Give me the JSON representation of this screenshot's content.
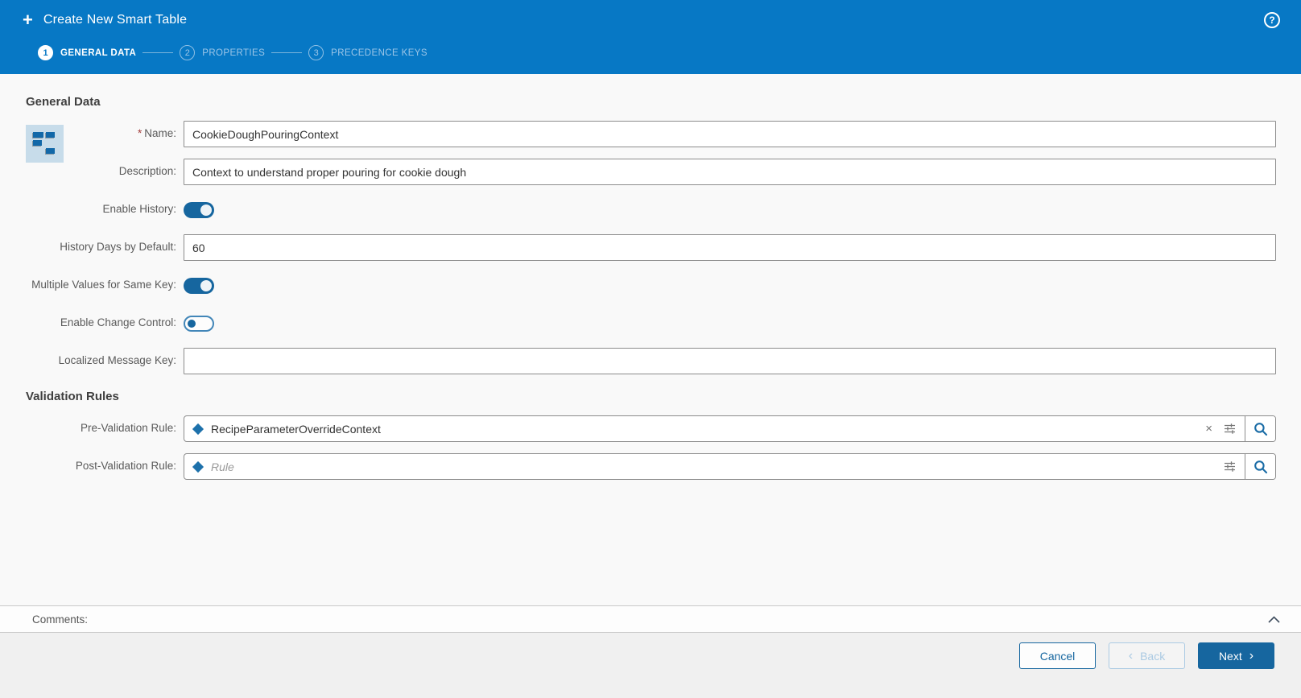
{
  "header": {
    "title": "Create New Smart Table",
    "plus_glyph": "+",
    "help_glyph": "?",
    "steps": [
      {
        "number": "1",
        "label": "GENERAL DATA",
        "state": "active"
      },
      {
        "number": "2",
        "label": "PROPERTIES",
        "state": "inactive"
      },
      {
        "number": "3",
        "label": "PRECEDENCE KEYS",
        "state": "inactive"
      }
    ]
  },
  "general_section": {
    "heading": "General Data",
    "fields": {
      "name": {
        "label": "Name:",
        "required_mark": "*",
        "value": "CookieDoughPouringContext"
      },
      "description": {
        "label": "Description:",
        "value": "Context to understand proper pouring for cookie dough"
      },
      "enable_history": {
        "label": "Enable History:",
        "state": "on"
      },
      "history_days": {
        "label": "History Days by Default:",
        "value": "60"
      },
      "multiple_values": {
        "label": "Multiple Values for Same Key:",
        "state": "on"
      },
      "enable_change_control": {
        "label": "Enable Change Control:",
        "state": "off"
      },
      "localized_message_key": {
        "label": "Localized Message Key:",
        "value": ""
      }
    }
  },
  "validation_section": {
    "heading": "Validation Rules",
    "pre_validation": {
      "label": "Pre-Validation Rule:",
      "value": "RecipeParameterOverrideContext",
      "clear_glyph": "×"
    },
    "post_validation": {
      "label": "Post-Validation Rule:",
      "placeholder": "Rule"
    }
  },
  "comments": {
    "label": "Comments:"
  },
  "footer": {
    "cancel_label": "Cancel",
    "back_label": "Back",
    "back_chevron": "‹",
    "next_label": "Next",
    "next_chevron": "›"
  },
  "colors": {
    "header_blue": "#0778c5",
    "primary_button_blue": "#16669f",
    "toggle_on_blue": "#16669f",
    "diamond_blue": "#1d71ab",
    "inactive_step_blue": "#9cc6e8",
    "required_red": "#a33c3a"
  }
}
